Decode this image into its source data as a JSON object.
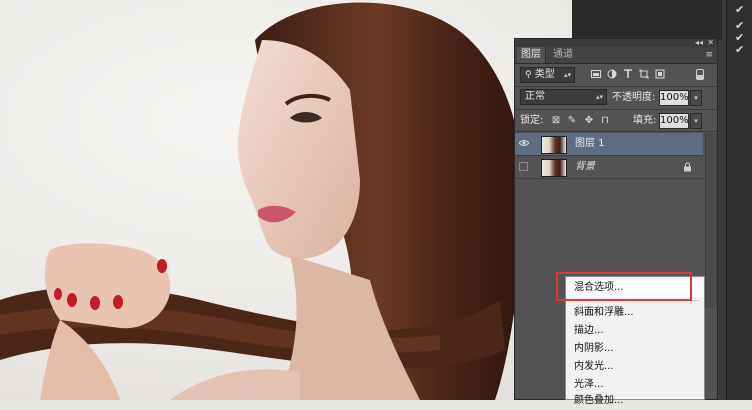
{
  "panel": {
    "tabs": [
      "图层",
      "通道"
    ],
    "filter_kind": "类型",
    "blend_mode": "正常",
    "opacity_label": "不透明度:",
    "opacity_value": "100%",
    "lock_label": "锁定:",
    "fill_label": "填充:",
    "fill_value": "100%",
    "collapse_glyph": "◂◂",
    "close_glyph": "✕",
    "menu_glyph": "≡"
  },
  "layers": [
    {
      "name": "图层 1",
      "selected": true,
      "visible": true
    },
    {
      "name": "背景",
      "selected": false,
      "visible": false,
      "locked": true
    }
  ],
  "context_menu": {
    "items": [
      "混合选项...",
      "斜面和浮雕...",
      "描边...",
      "内阴影...",
      "内发光...",
      "光泽...",
      "颜色叠加..."
    ],
    "highlighted_index": 0
  },
  "checks": [
    "✔",
    "✔",
    "✔",
    "✔"
  ],
  "colors": {
    "panel_bg": "#535353",
    "selected_layer": "#5f6d83",
    "highlight_border": "#d83a3a"
  }
}
